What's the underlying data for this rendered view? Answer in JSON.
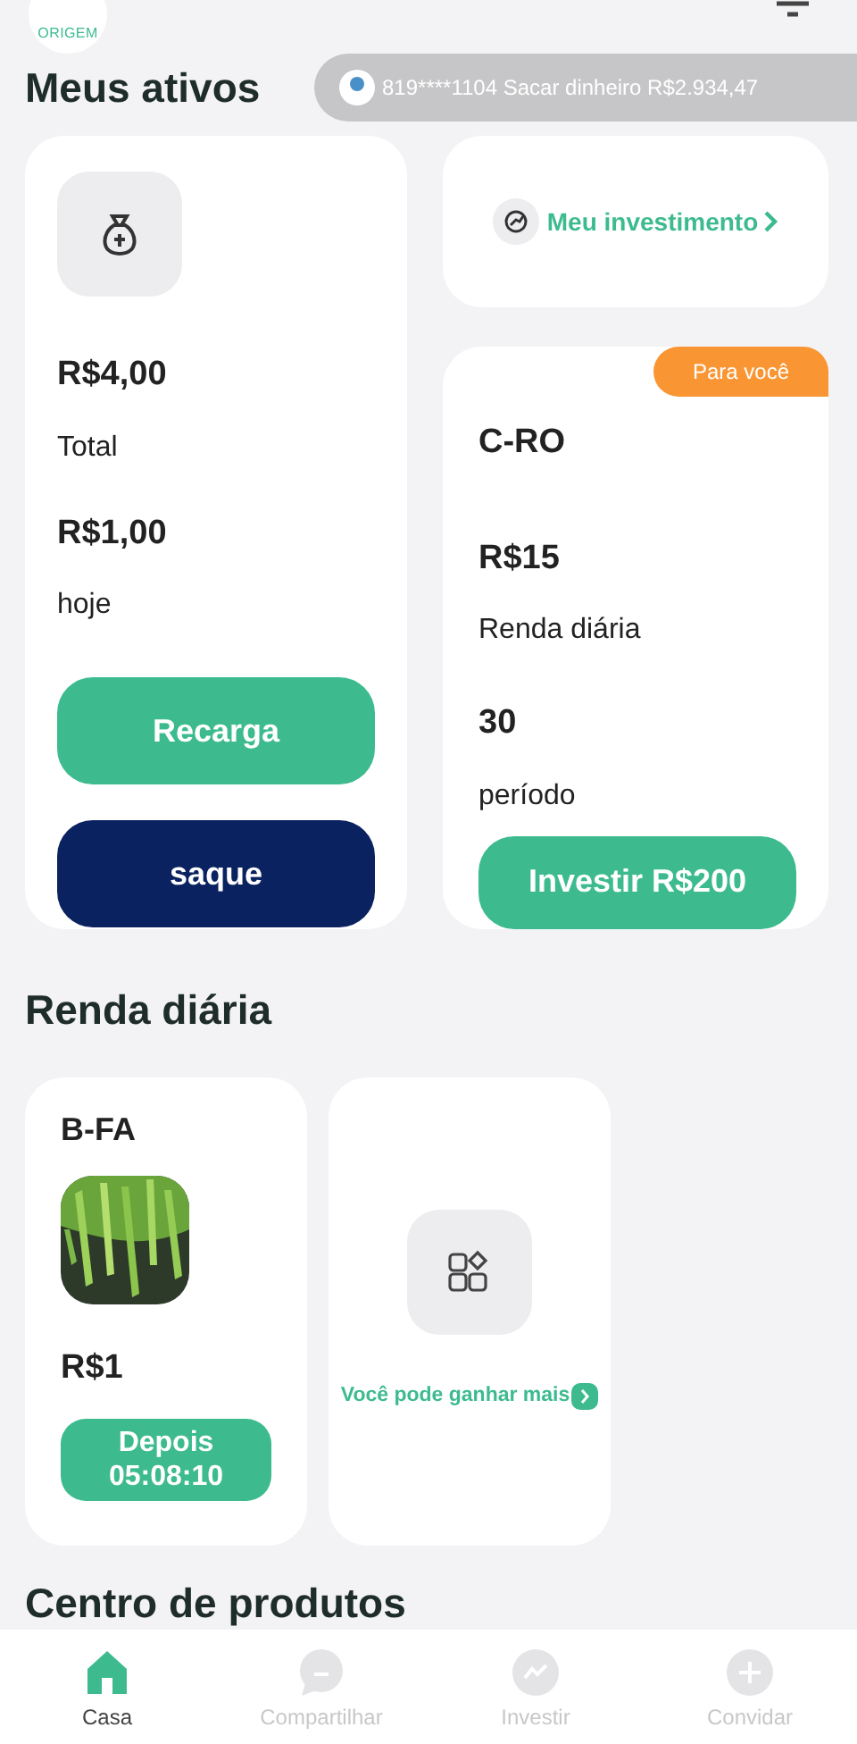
{
  "header": {
    "logo_text": "ORIGEM"
  },
  "notice": {
    "text": "819****1104 Sacar dinheiro R$2.934,47"
  },
  "assets": {
    "title": "Meus ativos",
    "total_value": "R$4,00",
    "total_label": "Total",
    "today_value": "R$1,00",
    "today_label": "hoje",
    "buttons": [
      {
        "label": "Recarga",
        "kind": "primary"
      },
      {
        "label": "saque",
        "kind": "dark"
      }
    ]
  },
  "my_investment": {
    "label": "Meu investimento"
  },
  "featured": {
    "badge": "Para você",
    "name": "C-RO",
    "price": "R$15",
    "price_label": "Renda diária",
    "period": "30",
    "period_label": "período",
    "button": "Investir R$200"
  },
  "daily": {
    "title": "Renda diária",
    "product": {
      "name": "B-FA",
      "price": "R$1",
      "button": "Depois 05:08:10"
    },
    "more": {
      "label": "Você pode ganhar mais"
    }
  },
  "products_title": "Centro de produtos",
  "nav": [
    {
      "label": "Casa",
      "selected": true
    },
    {
      "label": "Compartilhar",
      "selected": false
    },
    {
      "label": "Investir",
      "selected": false
    },
    {
      "label": "Convidar",
      "selected": false
    }
  ]
}
